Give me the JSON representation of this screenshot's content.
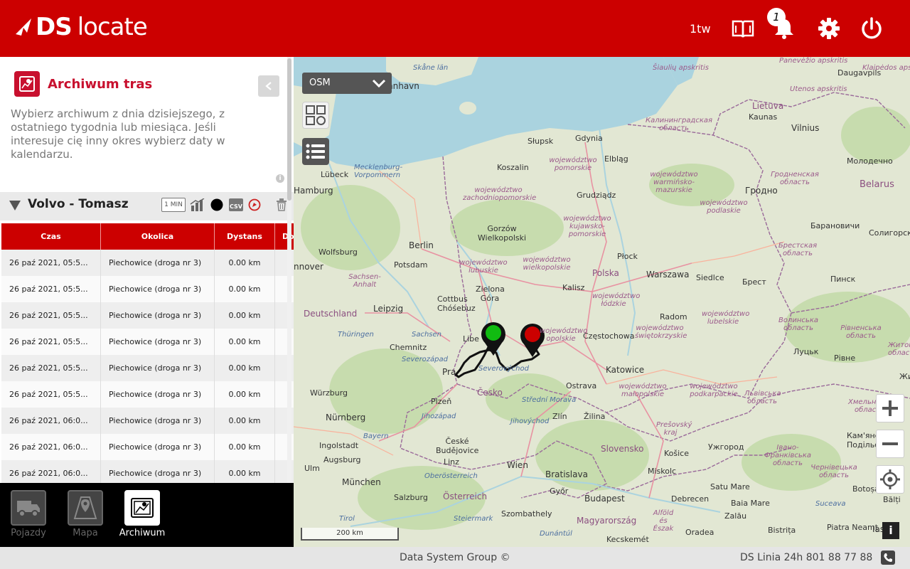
{
  "header": {
    "logo_ds": "DS",
    "logo_locate": "locate",
    "user_label": "1tw",
    "notifications_count": "1"
  },
  "panel": {
    "title": "Archiwum tras",
    "description": "Wybierz archiwum z dnia dzisiejszego, z ostatniego tygodnia lub miesiąca. Jeśli interesuje cię inny okres wybierz daty w kalendarzu.",
    "info_glyph": "i",
    "vehicle": {
      "name": "Volvo - Tomasz",
      "interval_tag": "1 MIN",
      "csv_label": "CSV",
      "color": "#000000"
    },
    "table": {
      "columns": [
        "Czas",
        "Okolica",
        "Dystans",
        "Do"
      ],
      "rows": [
        [
          "26 paź 2021, 05:5...",
          "Piechowice (droga nr 3)",
          "0.00 km"
        ],
        [
          "26 paź 2021, 05:5...",
          "Piechowice (droga nr 3)",
          "0.00 km"
        ],
        [
          "26 paź 2021, 05:5...",
          "Piechowice (droga nr 3)",
          "0.00 km"
        ],
        [
          "26 paź 2021, 05:5...",
          "Piechowice (droga nr 3)",
          "0.00 km"
        ],
        [
          "26 paź 2021, 05:5...",
          "Piechowice (droga nr 3)",
          "0.00 km"
        ],
        [
          "26 paź 2021, 05:5...",
          "Piechowice (droga nr 3)",
          "0.00 km"
        ],
        [
          "26 paź 2021, 06:0...",
          "Piechowice (droga nr 3)",
          "0.00 km"
        ],
        [
          "26 paź 2021, 06:0...",
          "Piechowice (droga nr 3)",
          "0.00 km"
        ],
        [
          "26 paź 2021, 06:0...",
          "Piechowice (droga nr 3)",
          "0.00 km"
        ]
      ]
    }
  },
  "bottom_nav": [
    {
      "label": "Pojazdy",
      "icon": "truck-icon",
      "active": false
    },
    {
      "label": "Mapa",
      "icon": "map-pin-icon",
      "active": false
    },
    {
      "label": "Archiwum",
      "icon": "archive-map-icon",
      "active": true
    }
  ],
  "map": {
    "layer": "OSM",
    "scale": "200 km",
    "info": "i",
    "labels": {
      "skane": "Skåne län",
      "hnhavn": "hnhavn",
      "klaipeda": "Klaipėdos apskritis",
      "panevezio": "Panevėžio apskritis",
      "siauliu": "Šiaulių apskritis",
      "daugavpils": "Daugavpils",
      "utenos": "Utenos apskritis",
      "lietuva": "Lietuva",
      "kaunas": "Kaunas",
      "vilnius": "Vilnius",
      "kaliningrad": "Калининградская область",
      "slupsk": "Słupsk",
      "gdynia": "Gdynia",
      "pomorskie": "województwo pomorskie",
      "elblag": "Elbląg",
      "molodechno": "Молодечно",
      "mecklenburg": "Mecklenburg-Vorpommern",
      "koszalin": "Koszalin",
      "warminsko": "województwo warmińsko-mazurskie",
      "podlaskie": "województwo podlaskie",
      "grodno_obl": "Гродненская область",
      "grodno": "Гродно",
      "belarus": "Belarus",
      "lubeck": "Lübeck",
      "hamburg": "Hamburg",
      "zachodniopomorskie": "województwo zachodniopomorskie",
      "grudziadz": "Grudziądz",
      "kujawsko": "województwo kujawsko-pomorskie",
      "baranovichi": "Барановичи",
      "soligorsk": "Солигорск",
      "gorzow": "Gorzów Wielkopolski",
      "berlin": "Berlin",
      "wolfsburg": "Wolfsburg",
      "potsdam": "Potsdam",
      "plock": "Płock",
      "brest_obl": "Брестская область",
      "hannover": "nnover",
      "lubuskie": "województwo lubuskie",
      "wielkopolskie": "województwo wielkopolskie",
      "polska": "Polska",
      "warszawa": "Warszawa",
      "siedlce": "Siedlce",
      "brest": "Брест",
      "pinsk": "Пинск",
      "sachsen_anhalt": "Sachsen-Anhalt",
      "zielona": "Zielona Góra",
      "kalisz": "Kalisz",
      "cottbus": "Cottbus Chóśebuz",
      "lodzkie": "województwo łódzkie",
      "deutschland": "Deutschland",
      "leipzig": "Leipzig",
      "radom": "Radom",
      "lubelskie": "województwo lubelskie",
      "volynska": "Волинська область",
      "rivnenska": "Рівненська область",
      "zhytomyr": "Житомир область",
      "thuringen": "Thüringen",
      "sachsen": "Sachsen",
      "czestochowa": "Częstochowa",
      "swietokrzyskie": "województwo świętokrzyskie",
      "chemnitz": "Chemnitz",
      "liberec": "Libe",
      "opolskie": "województwo opolskie",
      "lutsk": "Луцьк",
      "rivne": "Рівне",
      "severozapad": "Severozápad",
      "severovychod": "Severovýchod",
      "katowice": "Katowice",
      "praha": "Pra",
      "zhyt": "Жит",
      "wurzburg": "Würzburg",
      "cesko": "Česko",
      "ostrava": "Ostrava",
      "malopolskie": "województwo małopolskie",
      "podkarpackie": "województwo podkarpackie",
      "lvivska": "Львівська область",
      "plzen": "Plzeň",
      "stredni_morava": "Střední Morava",
      "zlin": "Zlín",
      "zilina": "Žilina",
      "khmelnytska": "Хмельницька область",
      "nurnberg": "Nürnberg",
      "jihozapad": "Jihozápad",
      "jihovychod": "Jihovýchod",
      "presovsky": "Prešovský kraj",
      "bayern": "Bayern",
      "ceske_budejovice": "České Budějovice",
      "kamianets": "Кам'янець-Подільський",
      "ingolstadt": "Ingolstadt",
      "slovensko": "Slovensko",
      "kosice": "Košice",
      "uzhhorod": "Ужгород",
      "ivano": "Івано-Франківська область",
      "augsburg": "Augsburg",
      "linz": "Linz",
      "ulm": "Ulm",
      "wien": "Wien",
      "bratislava": "Bratislava",
      "miskolc": "Miskolc",
      "chernivetska": "Чернівецька область",
      "munchen": "München",
      "oberosterreich": "Oberösterreich",
      "satu_mare": "Satu Mare",
      "botosani": "Botoșani",
      "salzburg": "Salzburg",
      "osterreich": "Österreich",
      "gyor": "Győr",
      "budapest": "Budapest",
      "debrecen": "Debrecen",
      "baia_mare": "Baia Mare",
      "suceava": "Suceava",
      "balti": "Bălți",
      "tirol": "Tirol",
      "steiermark": "Steiermark",
      "szombathely": "Szombathely",
      "zalau": "Zalău",
      "magyarorszag": "Magyarország",
      "alfold": "Alföld és Észak",
      "oradea": "Oradea",
      "bistrita": "Bistrița",
      "piatra": "Piatra Neamț",
      "iasi": "Ias",
      "dunantul": "Dunántúl",
      "kecskemet": "Kecskemét"
    }
  },
  "footer": {
    "copyright": "Data System Group ©",
    "hotline": "DS Linia 24h 801 88 77 88"
  },
  "colors": {
    "brand": "#cc0000",
    "start_marker": "#11bb11",
    "end_marker": "#cc0000"
  }
}
